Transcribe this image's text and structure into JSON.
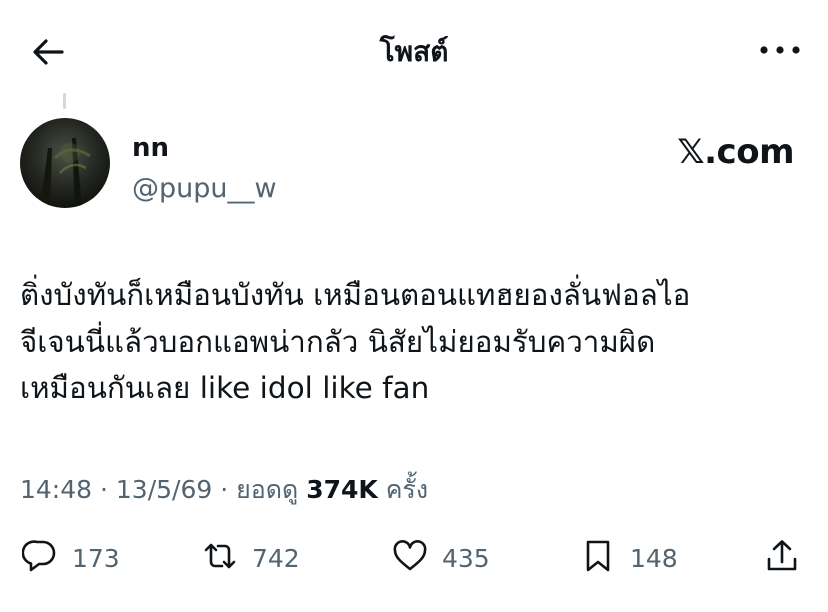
{
  "header": {
    "title": "โพสต์",
    "back_icon": "arrow-left-icon",
    "more_icon": "more-horizontal-icon"
  },
  "post": {
    "author": {
      "name": "nn",
      "handle": "@pupu__w"
    },
    "watermark": "𝕏.com",
    "text_lines": [
      "ติ่งบังทันก็เหมือนบังทัน เหมือนตอนแทฮยองลั่นฟอลไอ",
      "จีเจนนี่แล้วบอกแอพน่ากลัว นิสัยไม่ยอมรับความผิด",
      "เหมือนกันเลย like idol like fan"
    ],
    "meta": {
      "time": "14:48",
      "sep1": " · ",
      "date": "13/5/69",
      "sep2": " · ",
      "views_label": "ยอดดู ",
      "views": "374K",
      "views_suffix": " ครั้ง"
    },
    "actions": {
      "replies": "173",
      "reposts": "742",
      "likes": "435",
      "bookmarks": "148"
    }
  },
  "colors": {
    "text": "#0f1419",
    "muted": "#536471",
    "divider": "#cfd9de"
  }
}
